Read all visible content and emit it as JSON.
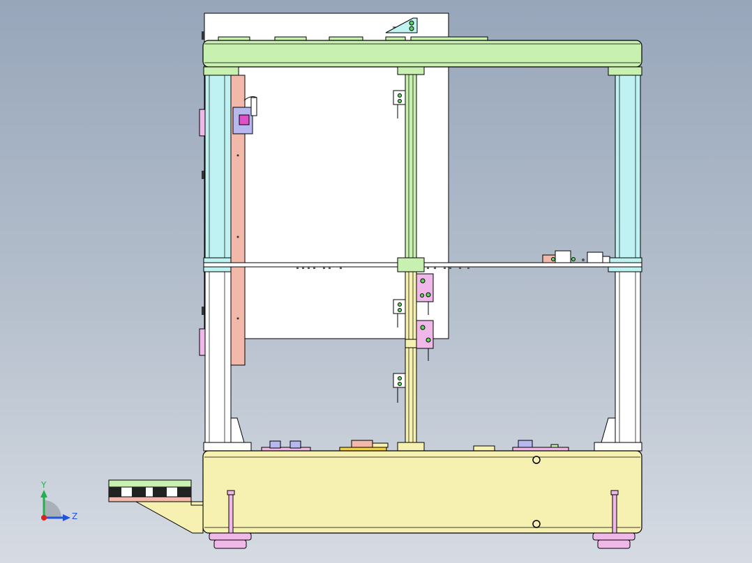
{
  "viewport": {
    "background_top": "#97a6ba",
    "background_bottom": "#d6dbe3"
  },
  "triad": {
    "y_label": "Y",
    "z_label": "Z",
    "y_color": "#22b14c",
    "z_color": "#2255dd",
    "x_color": "#dd2222"
  },
  "palette": {
    "frame_green": "#c8f0b0",
    "frame_cyan": "#bff3f3",
    "base_yellow": "#f6f1b0",
    "panel_salmon": "#f2b8aa",
    "pink": "#f0b8e8",
    "lavender": "#b8b8f0",
    "outline": "#000000"
  }
}
